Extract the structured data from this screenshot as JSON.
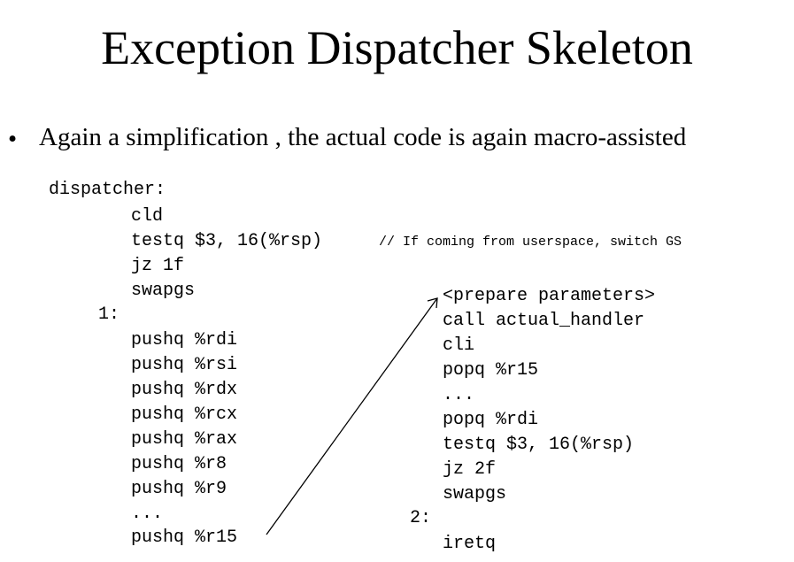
{
  "title": "Exception Dispatcher Skeleton",
  "bullet": "Again a simplification , the actual code is again macro-assisted",
  "left_code": {
    "label": "dispatcher:",
    "cld": "cld",
    "testq": "testq $3, 16(%rsp)",
    "comment": "// If coming from userspace, switch GS",
    "jz": "jz 1f",
    "swapgs": "swapgs",
    "label1": "1:",
    "push_rdi": "pushq %rdi",
    "push_rsi": "pushq %rsi",
    "push_rdx": "pushq %rdx",
    "push_rcx": "pushq %rcx",
    "push_rax": "pushq %rax",
    "push_r8": "pushq %r8",
    "push_r9": "pushq %r9",
    "ellipsis": "...",
    "push_r15": "pushq %r15"
  },
  "right_code": {
    "prepare": "<prepare parameters>",
    "call": "call actual_handler",
    "cli": "cli",
    "pop_r15": "popq %r15",
    "ellipsis": "...",
    "pop_rdi": "popq %rdi",
    "testq": "testq $3, 16(%rsp)",
    "jz": "jz 2f",
    "swapgs": "swapgs",
    "label2": "2:",
    "iretq": "iretq"
  }
}
